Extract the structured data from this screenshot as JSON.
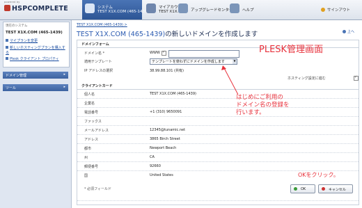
{
  "header": {
    "logo_prefix": "powered by",
    "logo": "HSPCOMPLETE",
    "tabs": [
      {
        "line1": "システム",
        "line2": "TEST X1X.COM (465-1439)"
      },
      {
        "line1": "マイアカウント",
        "line2": "TEST X1X.COM"
      },
      {
        "line1": "アップグレードセンター",
        "line2": ""
      },
      {
        "line1": "ヘルプ",
        "line2": ""
      }
    ],
    "signout": "サインアウト"
  },
  "sidebar": {
    "box_title": "現在のシステム",
    "system": "TEST X1X.COM (465-1439)",
    "links": [
      "マイプランを変更",
      "新しいホスティングプランを購入する",
      "Plesk クライアント プロパティ"
    ],
    "sections": [
      "ドメイン管理",
      "ツール"
    ]
  },
  "main": {
    "breadcrumb": "TEST X1X.COM (465-1439) >",
    "title_highlight": "TEST X1X.COM (465-1439)",
    "title_rest": "の新しいドメインを作成します",
    "up_label": "上へ",
    "domain_form": {
      "heading": "ドメインフォーム",
      "domain_label": "ドメイン名 *",
      "www_label": "WWW",
      "domain_value": "",
      "template_label": "適用テンプレート",
      "template_value": "テンプレートを使わずにドメインを作成します",
      "ip_label": "IP アドレスの選択",
      "ip_value": "38.99.88.101 (共有)",
      "hosting_label": "ホスティング設定に進む"
    },
    "client_card": {
      "heading": "クライアントカード",
      "rows": [
        {
          "label": "個人名",
          "value": "TEST X1X.COM (465-1439)"
        },
        {
          "label": "企業名",
          "value": ""
        },
        {
          "label": "電話番号",
          "value": "+1 (310) 9650091"
        },
        {
          "label": "ファックス",
          "value": ""
        },
        {
          "label": "メールアドレス",
          "value": "12345@tunamic.net"
        },
        {
          "label": "アドレス",
          "value": "3865 Birch Street"
        },
        {
          "label": "都市",
          "value": "Newport Beach"
        },
        {
          "label": "州",
          "value": "CA"
        },
        {
          "label": "郵便番号",
          "value": "92660"
        },
        {
          "label": "国",
          "value": "United States"
        }
      ]
    },
    "required_note": "* 必須フィールド",
    "ok_label": "OK",
    "cancel_label": "キャンセル"
  },
  "annotations": {
    "title": "PLESK管理画面",
    "note_lines": [
      "はじめにご利用の",
      "ドメイン名の登録を",
      "行います。"
    ],
    "ok_note": "OKをクリック。"
  },
  "colors": {
    "accent": "#2c5595",
    "annotation": "#e8323c"
  }
}
